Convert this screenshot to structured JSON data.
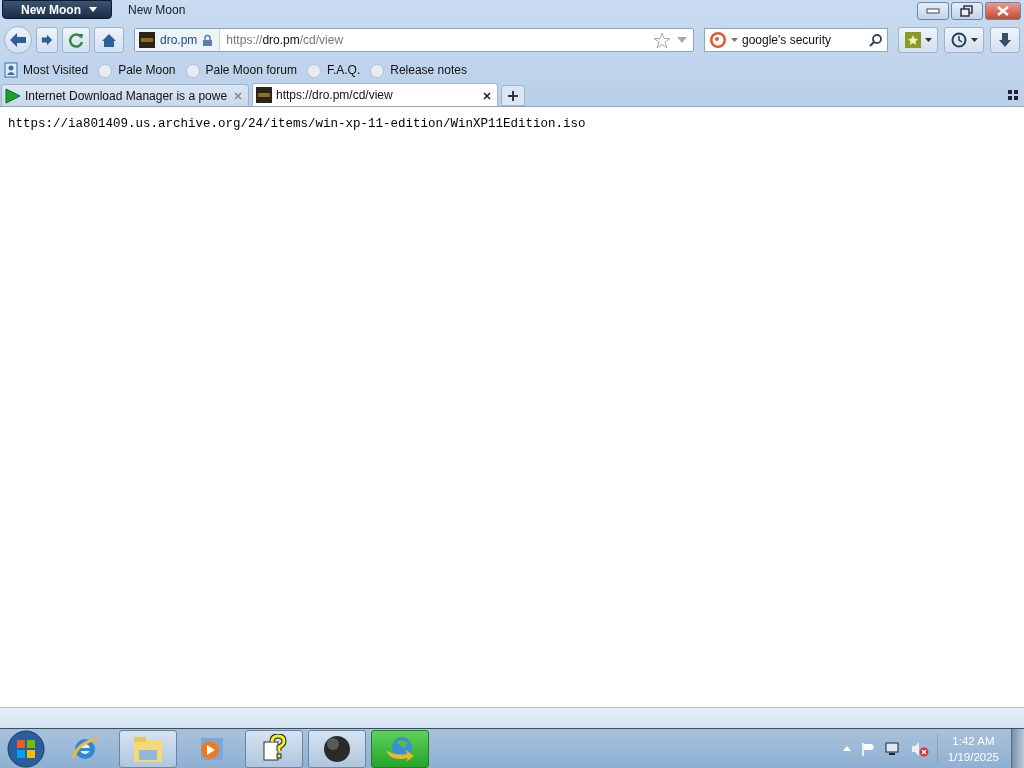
{
  "app_menu": {
    "label": "New Moon"
  },
  "window": {
    "title": "New Moon"
  },
  "nav": {
    "site_identity": "dro.pm",
    "url_scheme": "https://",
    "url_host": "dro.pm",
    "url_path": "/cd/view",
    "search_value": "google's security"
  },
  "bookmarks": [
    {
      "label": "Most Visited",
      "kind": "folder"
    },
    {
      "label": "Pale Moon",
      "kind": "page"
    },
    {
      "label": "Pale Moon forum",
      "kind": "page"
    },
    {
      "label": "F.A.Q.",
      "kind": "page"
    },
    {
      "label": "Release notes",
      "kind": "page"
    }
  ],
  "tabs": [
    {
      "label": "Internet Download Manager is a powe",
      "selected": false,
      "kind": "play"
    },
    {
      "label": "https://dro.pm/cd/view",
      "selected": true,
      "kind": "site"
    }
  ],
  "page": {
    "text": "https://ia801409.us.archive.org/24/items/win-xp-11-edition/WinXP11Edition.iso"
  },
  "taskbar": [
    {
      "kind": "ie",
      "open": false,
      "selected": false
    },
    {
      "kind": "explorer",
      "open": true,
      "selected": false
    },
    {
      "kind": "media",
      "open": false,
      "selected": false
    },
    {
      "kind": "help",
      "open": true,
      "selected": false
    },
    {
      "kind": "moon",
      "open": true,
      "selected": false
    },
    {
      "kind": "idm",
      "open": true,
      "selected": true
    }
  ],
  "clock": {
    "time": "1:42 AM",
    "date": "1/19/2025"
  }
}
